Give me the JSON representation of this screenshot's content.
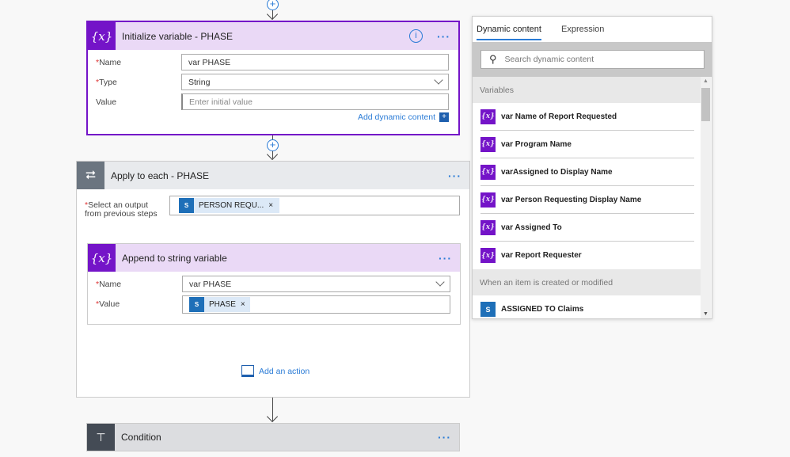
{
  "init_card": {
    "title": "Initialize variable - PHASE",
    "fields": [
      {
        "label": "Name",
        "required": true,
        "value": "var PHASE"
      },
      {
        "label": "Type",
        "required": true,
        "value": "String"
      },
      {
        "label": "Value",
        "required": false,
        "placeholder": "Enter initial value"
      }
    ],
    "add_dynamic": "Add dynamic content"
  },
  "apply_card": {
    "title": "Apply to each - PHASE",
    "select_label_1": "Select an output",
    "select_label_2": "from previous steps",
    "token": "PERSON REQU..."
  },
  "append_card": {
    "title": "Append to string variable",
    "name_label": "Name",
    "name_value": "var PHASE",
    "value_label": "Value",
    "value_token": "PHASE"
  },
  "add_action": "Add an action",
  "condition_card": {
    "title": "Condition"
  },
  "panel": {
    "tabs": [
      "Dynamic content",
      "Expression"
    ],
    "search_placeholder": "Search dynamic content",
    "sections": [
      {
        "title": "Variables",
        "items": [
          "var Name of Report Requested",
          "var Program Name",
          "varAssigned to Display Name",
          "var Person Requesting Display Name",
          "var Assigned To",
          "var Report Requester"
        ]
      },
      {
        "title": "When an item is created or modified",
        "items": [
          "ASSIGNED TO Claims"
        ]
      }
    ]
  },
  "icons": {
    "variable": "{x}",
    "sharepoint": "S",
    "remove": "×",
    "more": "···"
  },
  "colors": {
    "variable_purple": "#7414c8",
    "accent_blue": "#2a7bd6"
  }
}
